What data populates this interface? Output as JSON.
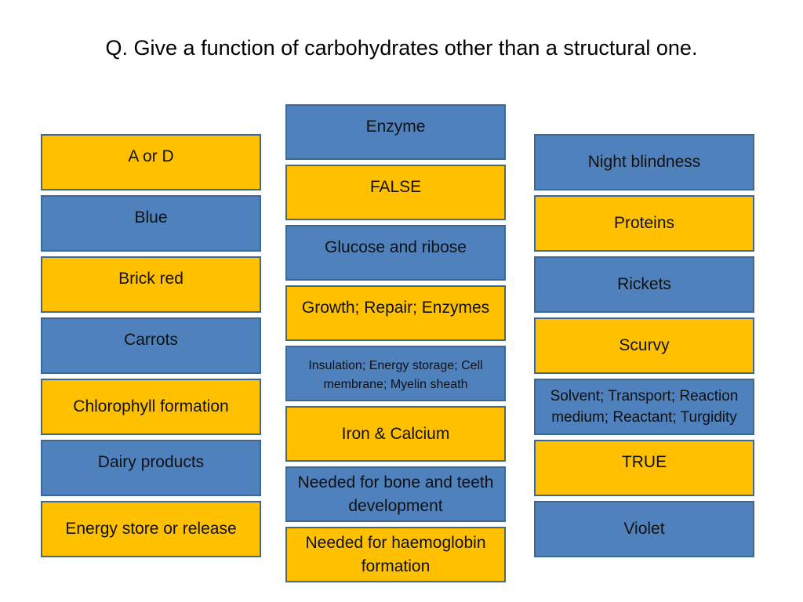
{
  "title": "Q. Give a function of carbohydrates other than a structural one.",
  "colors": {
    "blue": "#4f81bd",
    "gold": "#ffc000",
    "border": "#3c6896"
  },
  "columns": {
    "left": [
      {
        "text": "A or D",
        "color": "gold"
      },
      {
        "text": "Blue",
        "color": "blue"
      },
      {
        "text": "Brick red",
        "color": "gold"
      },
      {
        "text": "Carrots",
        "color": "blue"
      },
      {
        "text": "Chlorophyll formation",
        "color": "gold"
      },
      {
        "text": "Dairy products",
        "color": "blue"
      },
      {
        "text": "Energy store or release",
        "color": "gold"
      }
    ],
    "middle": [
      {
        "text": "Enzyme",
        "color": "blue"
      },
      {
        "text": "FALSE",
        "color": "gold"
      },
      {
        "text": "Glucose and ribose",
        "color": "blue"
      },
      {
        "text": "Growth; Repair; Enzymes",
        "color": "gold"
      },
      {
        "text": "Insulation; Energy storage; Cell membrane; Myelin sheath",
        "color": "blue"
      },
      {
        "text": "Iron & Calcium",
        "color": "gold"
      },
      {
        "text": "Needed for bone and teeth development",
        "color": "blue"
      },
      {
        "text": "Needed for haemoglobin formation",
        "color": "gold"
      }
    ],
    "right": [
      {
        "text": "Night blindness",
        "color": "blue"
      },
      {
        "text": "Proteins",
        "color": "gold"
      },
      {
        "text": "Rickets",
        "color": "blue"
      },
      {
        "text": "Scurvy",
        "color": "gold"
      },
      {
        "text": "Solvent; Transport; Reaction medium; Reactant; Turgidity",
        "color": "blue"
      },
      {
        "text": "TRUE",
        "color": "gold"
      },
      {
        "text": "Violet",
        "color": "blue"
      }
    ]
  }
}
